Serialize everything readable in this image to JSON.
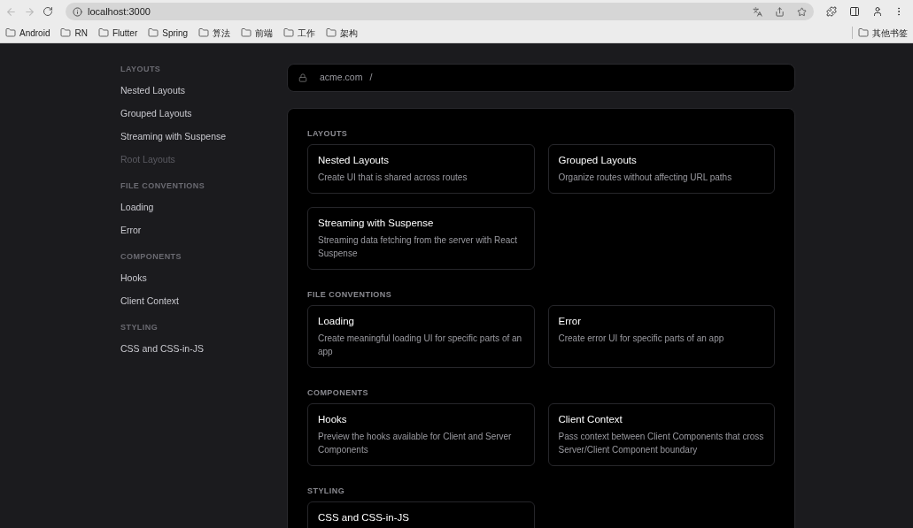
{
  "browser": {
    "address": "localhost:3000",
    "bookmarks": [
      "Android",
      "RN",
      "Flutter",
      "Spring",
      "算法",
      "前端",
      "工作",
      "架构"
    ],
    "other_bookmarks": "其他书签"
  },
  "sidebar": {
    "sections": [
      {
        "heading": "LAYOUTS",
        "items": [
          {
            "label": "Nested Layouts",
            "disabled": false
          },
          {
            "label": "Grouped Layouts",
            "disabled": false
          },
          {
            "label": "Streaming with Suspense",
            "disabled": false
          },
          {
            "label": "Root Layouts",
            "disabled": true
          }
        ]
      },
      {
        "heading": "FILE CONVENTIONS",
        "items": [
          {
            "label": "Loading",
            "disabled": false
          },
          {
            "label": "Error",
            "disabled": false
          }
        ]
      },
      {
        "heading": "COMPONENTS",
        "items": [
          {
            "label": "Hooks",
            "disabled": false
          },
          {
            "label": "Client Context",
            "disabled": false
          }
        ]
      },
      {
        "heading": "STYLING",
        "items": [
          {
            "label": "CSS and CSS-in-JS",
            "disabled": false
          }
        ]
      }
    ]
  },
  "url_bar": {
    "domain": "acme.com",
    "path": "/"
  },
  "sections": [
    {
      "heading": "LAYOUTS",
      "cards": [
        {
          "title": "Nested Layouts",
          "description": "Create UI that is shared across routes"
        },
        {
          "title": "Grouped Layouts",
          "description": "Organize routes without affecting URL paths"
        },
        {
          "title": "Streaming with Suspense",
          "description": "Streaming data fetching from the server with React Suspense"
        }
      ]
    },
    {
      "heading": "FILE CONVENTIONS",
      "cards": [
        {
          "title": "Loading",
          "description": "Create meaningful loading UI for specific parts of an app"
        },
        {
          "title": "Error",
          "description": "Create error UI for specific parts of an app"
        }
      ]
    },
    {
      "heading": "COMPONENTS",
      "cards": [
        {
          "title": "Hooks",
          "description": "Preview the hooks available for Client and Server Components"
        },
        {
          "title": "Client Context",
          "description": "Pass context between Client Components that cross Server/Client Component boundary"
        }
      ]
    },
    {
      "heading": "STYLING",
      "cards": [
        {
          "title": "CSS and CSS-in-JS"
        }
      ]
    }
  ]
}
